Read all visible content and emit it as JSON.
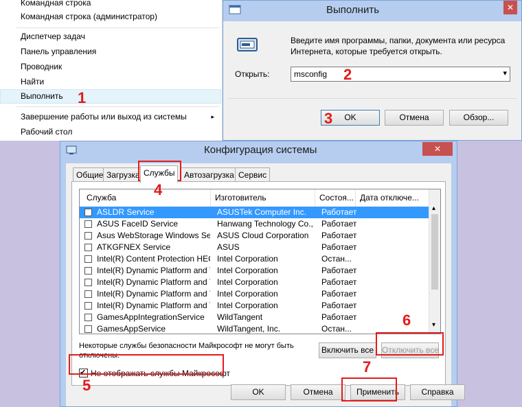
{
  "context_menu": {
    "items": [
      {
        "label": "Командная строка"
      },
      {
        "label": "Командная строка (администратор)"
      },
      {
        "label": "Диспетчер задач"
      },
      {
        "label": "Панель управления"
      },
      {
        "label": "Проводник"
      },
      {
        "label": "Найти"
      },
      {
        "label": "Выполнить",
        "highlighted": true
      },
      {
        "label": "Завершение работы или выход из системы",
        "submenu": true
      },
      {
        "label": "Рабочий стол"
      }
    ],
    "submenu_arrow": "▸"
  },
  "run_dialog": {
    "title": "Выполнить",
    "close_label": "✕",
    "description": "Введите имя программы, папки, документа или ресурса Интернета, которые требуется открыть.",
    "open_label": "Открыть:",
    "input_value": "msconfig",
    "dropdown_arrow": "▾",
    "buttons": {
      "ok": "OK",
      "cancel": "Отмена",
      "browse": "Обзор..."
    },
    "icon": "run-icon"
  },
  "msconfig": {
    "title": "Конфигурация системы",
    "close_label": "✕",
    "icon": "msconfig-icon",
    "tabs": [
      "Общие",
      "Загрузка",
      "Службы",
      "Автозагрузка",
      "Сервис"
    ],
    "active_tab": "Службы",
    "columns": [
      "Служба",
      "Изготовитель",
      "Состоя...",
      "Дата отключе..."
    ],
    "services": [
      {
        "name": "ASLDR Service",
        "vendor": "ASUSTek Computer Inc.",
        "status": "Работает",
        "selected": true
      },
      {
        "name": "ASUS FaceID Service",
        "vendor": "Hanwang Technology Co.,...",
        "status": "Работает"
      },
      {
        "name": "Asus WebStorage Windows Ser...",
        "vendor": "ASUS Cloud Corporation",
        "status": "Работает"
      },
      {
        "name": "ATKGFNEX Service",
        "vendor": "ASUS",
        "status": "Работает"
      },
      {
        "name": "Intel(R) Content Protection HEC...",
        "vendor": "Intel Corporation",
        "status": "Остан..."
      },
      {
        "name": "Intel(R) Dynamic Platform and T...",
        "vendor": "Intel Corporation",
        "status": "Работает"
      },
      {
        "name": "Intel(R) Dynamic Platform and T...",
        "vendor": "Intel Corporation",
        "status": "Работает"
      },
      {
        "name": "Intel(R) Dynamic Platform and T...",
        "vendor": "Intel Corporation",
        "status": "Работает"
      },
      {
        "name": "Intel(R) Dynamic Platform and T...",
        "vendor": "Intel Corporation",
        "status": "Работает"
      },
      {
        "name": "GamesAppIntegrationService",
        "vendor": "WildTangent",
        "status": "Работает"
      },
      {
        "name": "GamesAppService",
        "vendor": "WildTangent, Inc.",
        "status": "Остан..."
      }
    ],
    "scroll_up": "▴",
    "scroll_down": "▾",
    "notice": "Некоторые службы безопасности Майкрософт не могут быть отключены.",
    "enable_all": "Включить все",
    "disable_all": "Отключить все",
    "hide_ms_label": "Не отображать службы Майкрософт",
    "hide_ms_checked": true,
    "check_mark": "✔",
    "buttons": {
      "ok": "OK",
      "cancel": "Отмена",
      "apply": "Применить",
      "help": "Справка"
    }
  },
  "annotations": [
    "1",
    "2",
    "3",
    "4",
    "5",
    "6",
    "7"
  ],
  "colors": {
    "annotation": "#e21b1b",
    "selection": "#3399ff",
    "titlebar": "#b6cdef"
  }
}
